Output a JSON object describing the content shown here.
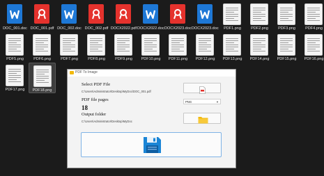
{
  "files": [
    {
      "name": "DOC_001.doc",
      "type": "doc",
      "selected": false
    },
    {
      "name": "DOC_001.pdf",
      "type": "pdf",
      "selected": false
    },
    {
      "name": "DOC_002.doc",
      "type": "doc",
      "selected": false
    },
    {
      "name": "DOC_002.pdf",
      "type": "pdf",
      "selected": false
    },
    {
      "name": "DOCX2022.pdf",
      "type": "pdf",
      "selected": false
    },
    {
      "name": "DOCX2022.docx",
      "type": "doc",
      "selected": false
    },
    {
      "name": "DOCX2023.docx",
      "type": "pdf",
      "selected": false
    },
    {
      "name": "DOCX2023.docx",
      "type": "doc",
      "selected": false
    },
    {
      "name": "PDF1.png",
      "type": "png",
      "selected": false
    },
    {
      "name": "PDF2.png",
      "type": "png",
      "selected": false
    },
    {
      "name": "PDF3.png",
      "type": "png",
      "selected": false
    },
    {
      "name": "PDF4.png",
      "type": "png",
      "selected": false
    },
    {
      "name": "PDF5.png",
      "type": "png",
      "selected": false
    },
    {
      "name": "PDF6.png",
      "type": "png",
      "selected": false
    },
    {
      "name": "PDF7.png",
      "type": "png",
      "selected": false
    },
    {
      "name": "PDF8.png",
      "type": "png",
      "selected": false
    },
    {
      "name": "PDF9.png",
      "type": "png",
      "selected": false
    },
    {
      "name": "PDF10.png",
      "type": "png",
      "selected": false
    },
    {
      "name": "PDF11.png",
      "type": "png",
      "selected": false
    },
    {
      "name": "PDF12.png",
      "type": "png",
      "selected": false
    },
    {
      "name": "PDF13.png",
      "type": "png",
      "selected": false
    },
    {
      "name": "PDF14.png",
      "type": "png",
      "selected": false
    },
    {
      "name": "PDF15.png",
      "type": "png",
      "selected": false
    },
    {
      "name": "PDF16.png",
      "type": "png",
      "selected": false
    },
    {
      "name": "PDF17.png",
      "type": "png",
      "selected": false
    },
    {
      "name": "PDF18.png",
      "type": "png",
      "selected": true
    }
  ],
  "colors": {
    "doc": "#1e78d6",
    "pdf": "#e5322d",
    "folder": "#f2b90c",
    "save": "#1a85d6"
  },
  "dialog": {
    "title": "PDF To Image",
    "select_label": "Select PDF File",
    "select_path": "C:\\Users\\Administrator\\Desktop\\MyDoc\\DOC_001.pdf",
    "pages_label": "PDF file pages",
    "pages_value": "18",
    "format_value": "PNG",
    "output_label": "Output folder",
    "output_path": "C:\\Users\\Administrator\\Desktop\\MyDoc",
    "icons": {
      "pdf_button": "pdf-file-icon",
      "folder_button": "folder-icon",
      "convert_button": "floppy-save-icon"
    }
  }
}
